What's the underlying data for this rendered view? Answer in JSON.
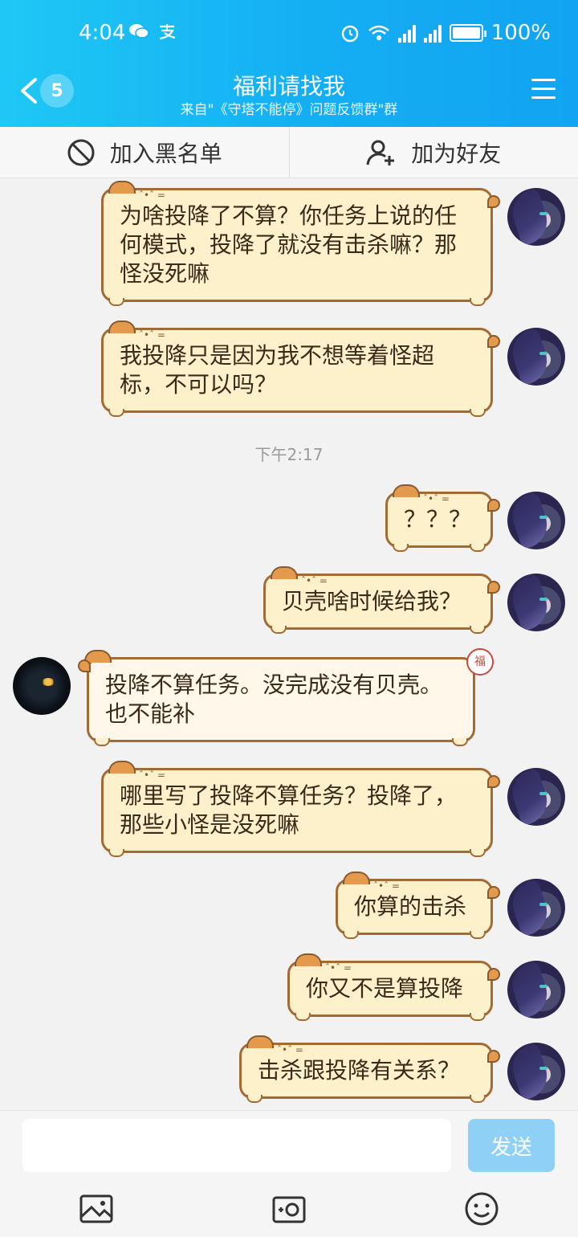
{
  "status_bar": {
    "time": "4:04",
    "battery": "100%",
    "network": "4G"
  },
  "header": {
    "unread_count": "5",
    "title": "福利请找我",
    "subtitle": "来自\"《守塔不能停》问题反馈群\"群"
  },
  "actions": {
    "blacklist_label": "加入黑名单",
    "add_friend_label": "加为好友"
  },
  "messages": [
    {
      "from": "me",
      "text": "为啥投降了不算？你任务上说的任何模式，投降了就没有击杀嘛？那怪没死嘛"
    },
    {
      "from": "me",
      "text": "我投降只是因为我不想等着怪超标，不可以吗？"
    },
    {
      "from": "me",
      "text": "？？？"
    },
    {
      "from": "me",
      "text": "贝壳啥时候给我？"
    },
    {
      "from": "other",
      "text": "投降不算任务。没完成没有贝壳。也不能补"
    },
    {
      "from": "me",
      "text": "哪里写了投降不算任务？投降了，那些小怪是没死嘛"
    },
    {
      "from": "me",
      "text": "你算的击杀"
    },
    {
      "from": "me",
      "text": "你又不是算投降"
    },
    {
      "from": "me",
      "text": "击杀跟投降有关系？"
    }
  ],
  "timestamp": "下午2:17",
  "input": {
    "placeholder": "",
    "send_label": "发送"
  },
  "colors": {
    "header_start": "#1ec8f5",
    "header_end": "#12a4f2",
    "bubble_fill": "#fdf1cc",
    "bubble_border": "#a36b34",
    "send_button": "#8fd0f7"
  }
}
